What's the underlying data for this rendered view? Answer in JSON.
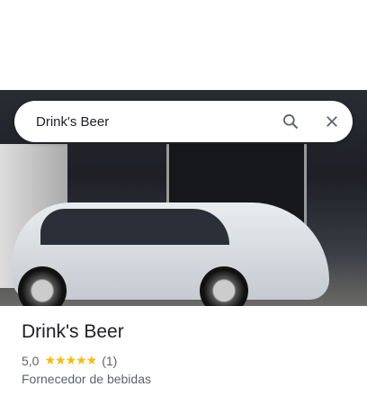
{
  "search": {
    "value": "Drink's Beer"
  },
  "place": {
    "name": "Drink's Beer",
    "rating": "5,0",
    "stars": "★★★★★",
    "review_count": "(1)",
    "category": "Fornecedor de bebidas"
  },
  "colors": {
    "star": "#fbbc04"
  }
}
